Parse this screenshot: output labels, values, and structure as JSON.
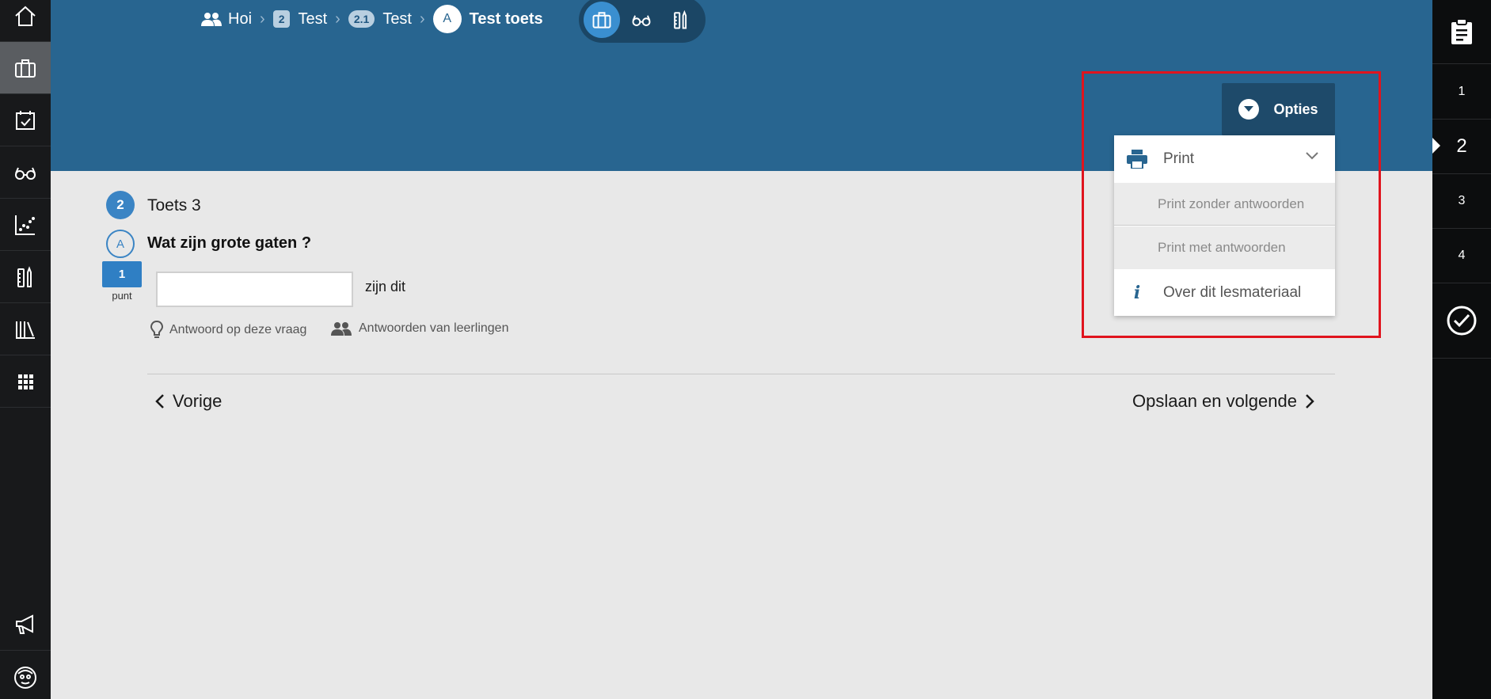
{
  "sidebar_left": {
    "items": [
      {
        "icon": "home-icon"
      },
      {
        "icon": "briefcase-icon",
        "active": true
      },
      {
        "icon": "calendar-check-icon"
      },
      {
        "icon": "glasses-icon"
      },
      {
        "icon": "chart-icon"
      },
      {
        "icon": "tools-icon"
      },
      {
        "icon": "library-icon"
      },
      {
        "icon": "apps-grid-icon"
      },
      {
        "icon": "megaphone-icon"
      },
      {
        "icon": "avatar-icon"
      }
    ]
  },
  "breadcrumb": {
    "home": "Hoi",
    "level1_badge": "2",
    "level1": "Test",
    "level2_badge": "2.1",
    "level2": "Test",
    "level3_badge": "A",
    "level3": "Test toets"
  },
  "options": {
    "button_label": "Opties",
    "menu": {
      "print": "Print",
      "print_without": "Print zonder antwoorden",
      "print_with": "Print met antwoorden",
      "about": "Over dit lesmateriaal"
    }
  },
  "question": {
    "number": "2",
    "title": "Toets 3",
    "sub_letter": "A",
    "text": "Wat zijn grote gaten ?",
    "points": "1",
    "points_label": "punt",
    "answer_value": "",
    "answer_suffix": "zijn dit",
    "help_answer": "Antwoord op deze vraag",
    "help_students": "Antwoorden van leerlingen"
  },
  "navigation": {
    "prev": "Vorige",
    "next": "Opslaan en volgende"
  },
  "sidebar_right": {
    "top_icon": "clipboard-icon",
    "items": [
      "1",
      "2",
      "3",
      "4"
    ],
    "current": "2",
    "bottom_icon": "check-circle-icon"
  },
  "colors": {
    "header": "#286590",
    "accent": "#3a84c4",
    "highlight": "#e0141e"
  }
}
